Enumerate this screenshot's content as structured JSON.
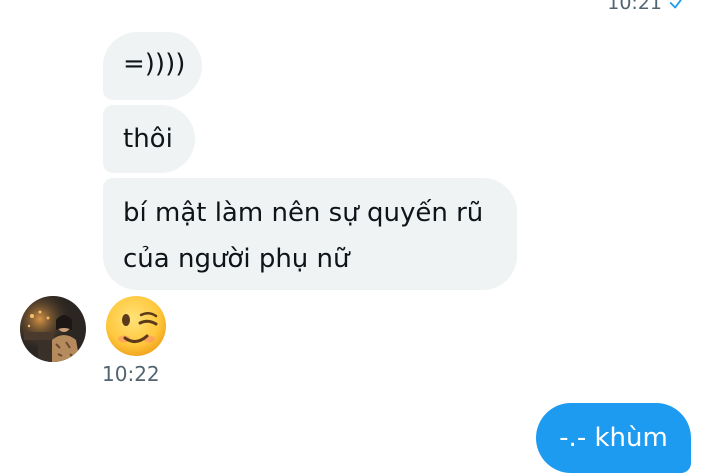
{
  "header": {
    "prev_time": "10:21"
  },
  "messages": {
    "received": [
      {
        "text": "=))))"
      },
      {
        "text": "thôi"
      },
      {
        "lines": [
          "bí mật làm nên sự quyến rũ",
          "của người phụ nữ"
        ]
      }
    ],
    "emoji": "winking-face",
    "received_time": "10:22",
    "sent": [
      {
        "text": "-.- khùm"
      }
    ]
  },
  "colors": {
    "received_bubble": "#eff3f4",
    "sent_bubble": "#1d9bf0",
    "timestamp": "#536471",
    "read_check": "#1d9bf0",
    "text": "#0f1419"
  },
  "icons": {
    "read_receipt": "check-icon",
    "avatar": "avatar",
    "emoji": "winking-face-emoji"
  }
}
